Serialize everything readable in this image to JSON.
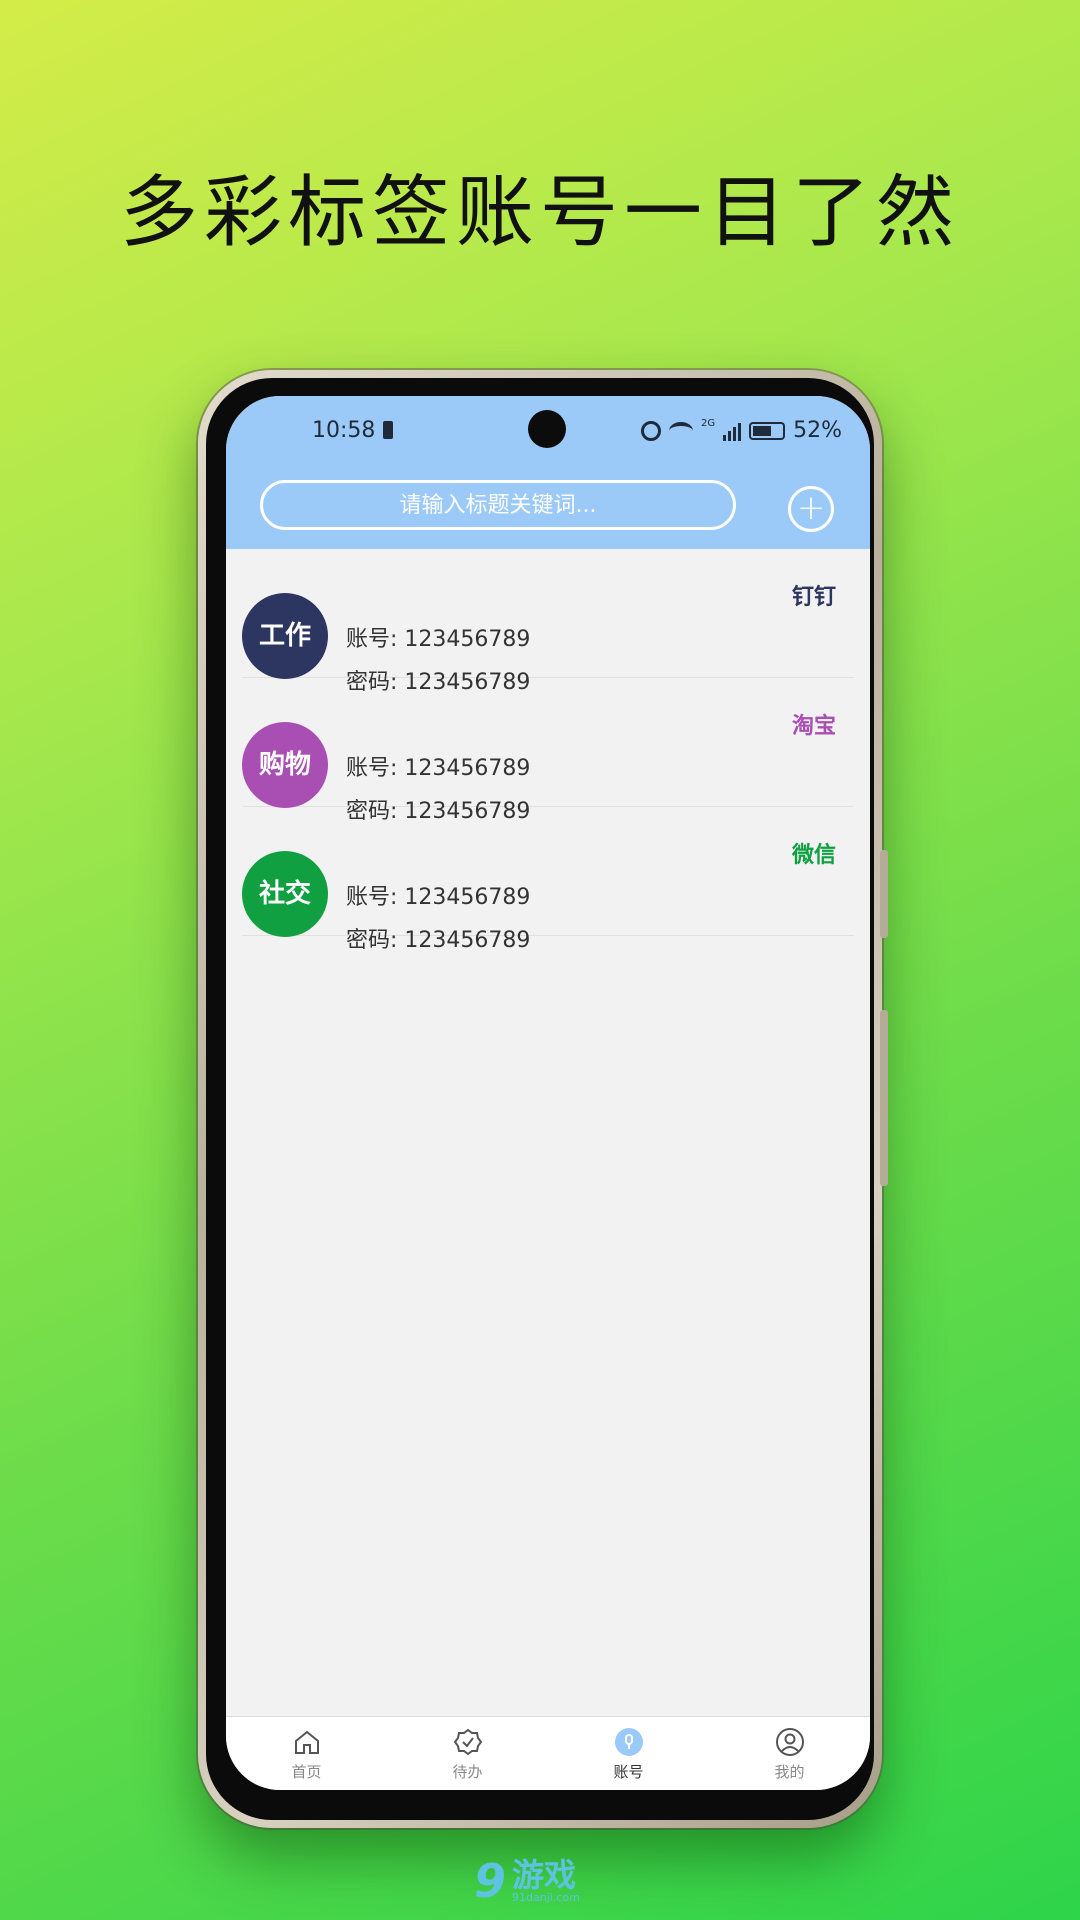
{
  "headline": "多彩标签账号一目了然",
  "status": {
    "time": "10:58",
    "network": "2G",
    "battery": "52%"
  },
  "search": {
    "placeholder": "请输入标题关键词..."
  },
  "add_label": "+",
  "accounts": [
    {
      "category": "工作",
      "tag": "钉钉",
      "account_label": "账号:",
      "account": "123456789",
      "password_label": "密码:",
      "password": "123456789",
      "color": "#2d3561"
    },
    {
      "category": "购物",
      "tag": "淘宝",
      "account_label": "账号:",
      "account": "123456789",
      "password_label": "密码:",
      "password": "123456789",
      "color": "#a94fb4"
    },
    {
      "category": "社交",
      "tag": "微信",
      "account_label": "账号:",
      "account": "123456789",
      "password_label": "密码:",
      "password": "123456789",
      "color": "#10a042"
    }
  ],
  "tabs": [
    {
      "label": "首页",
      "icon": "home-icon"
    },
    {
      "label": "待办",
      "icon": "todo-check-icon"
    },
    {
      "label": "账号",
      "icon": "account-key-icon",
      "active": true
    },
    {
      "label": "我的",
      "icon": "profile-icon"
    }
  ],
  "colors": {
    "accent": "#9ccaf8",
    "tab_active": "#9ccaf8"
  },
  "watermark": {
    "number": "9",
    "text": "游戏",
    "sub": "91danji.com"
  }
}
